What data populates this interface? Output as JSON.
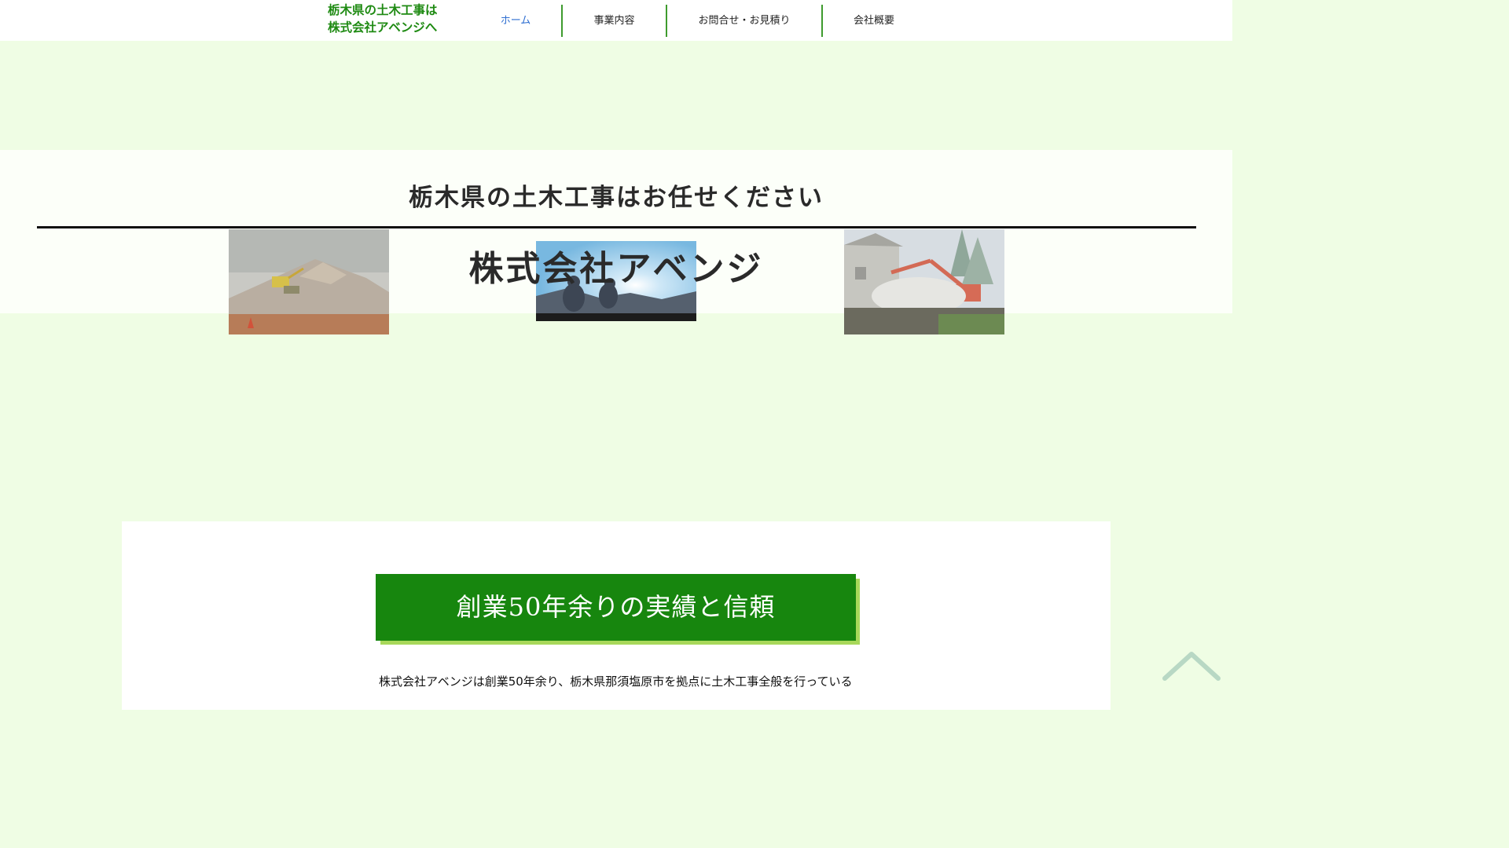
{
  "header": {
    "logo_line1": "栃木県の土木工事は",
    "logo_line2": "株式会社アベンジへ",
    "nav": [
      {
        "label": "ホーム"
      },
      {
        "label": "事業内容"
      },
      {
        "label": "お問合せ・お見積り"
      },
      {
        "label": "会社概要"
      }
    ]
  },
  "hero": {
    "subtitle": "栃木県の土木工事はお任せください",
    "title": "株式会社アベンジ"
  },
  "section": {
    "heading": "創業50年余りの実績と信頼",
    "intro": "株式会社アベンジは創業50年余り、栃木県那須塩原市を拠点に土木工事全般を行っている"
  },
  "colors": {
    "brand_green": "#17860e",
    "logo_green": "#1e8a12",
    "page_background": "#effde4",
    "active_nav": "#2f6fd1"
  },
  "icons": {
    "back_to_top": "chevron-up-icon"
  }
}
